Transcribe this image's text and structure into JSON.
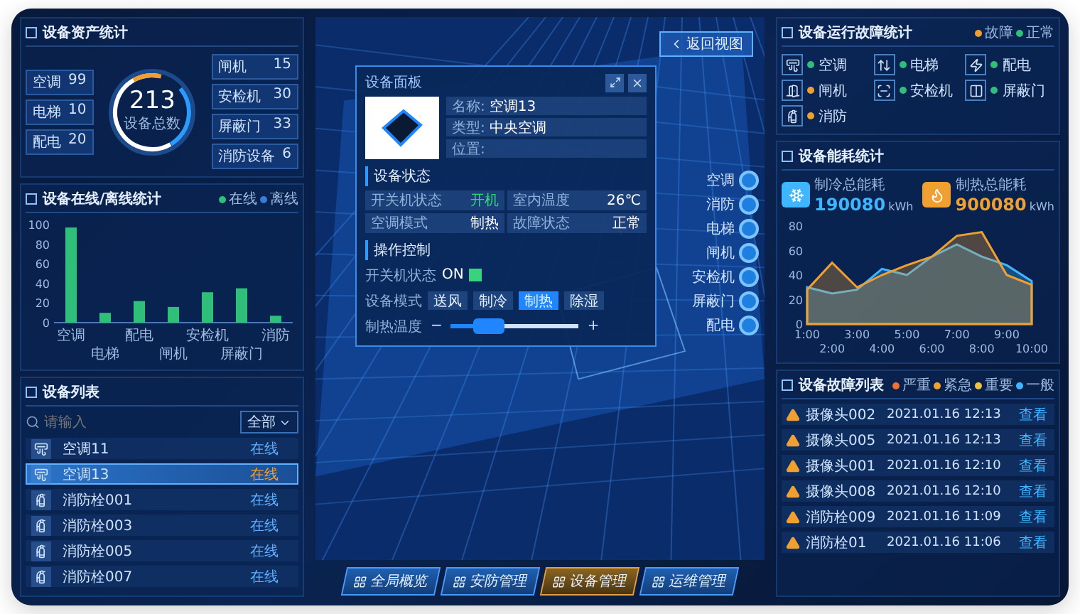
{
  "asset_stats": {
    "title": "设备资产统计",
    "left_items": [
      {
        "label": "空调",
        "value": "99"
      },
      {
        "label": "电梯",
        "value": "10"
      },
      {
        "label": "配电",
        "value": "20"
      }
    ],
    "total": {
      "value": "213",
      "label": "设备总数"
    },
    "right_items": [
      {
        "label": "闸机",
        "value": "15"
      },
      {
        "label": "安检机",
        "value": "30"
      },
      {
        "label": "屏蔽门",
        "value": "33"
      },
      {
        "label": "消防设备",
        "value": "6"
      }
    ]
  },
  "online_stats": {
    "title": "设备在线/离线统计",
    "legend": [
      {
        "label": "在线",
        "color": "#2fbf7a"
      },
      {
        "label": "离线",
        "color": "#3a7bd5"
      }
    ],
    "chart_data": {
      "type": "bar",
      "categories": [
        "空调",
        "电梯",
        "配电",
        "闸机",
        "安检机",
        "屏蔽门",
        "消防"
      ],
      "series": [
        {
          "color": "#2fbf7a",
          "values": [
            97,
            10,
            22,
            16,
            31,
            35,
            7
          ]
        }
      ],
      "ylim": [
        0,
        100
      ],
      "yticks": [
        0,
        20,
        40,
        60,
        80,
        100
      ]
    }
  },
  "device_list": {
    "title": "设备列表",
    "search": {
      "placeholder": "请输入"
    },
    "filter": "全部",
    "rows": [
      {
        "kind": "ac",
        "name": "空调11",
        "status": "在线",
        "selected": false
      },
      {
        "kind": "ac",
        "name": "空调13",
        "status": "在线",
        "selected": true
      },
      {
        "kind": "hydrant",
        "name": "消防栓001",
        "status": "在线",
        "selected": false
      },
      {
        "kind": "hydrant",
        "name": "消防栓003",
        "status": "在线",
        "selected": false
      },
      {
        "kind": "hydrant",
        "name": "消防栓005",
        "status": "在线",
        "selected": false
      },
      {
        "kind": "hydrant",
        "name": "消防栓007",
        "status": "在线",
        "selected": false
      }
    ]
  },
  "scene": {
    "back_button": "返回视图",
    "layers": [
      {
        "label": "空调"
      },
      {
        "label": "消防"
      },
      {
        "label": "电梯"
      },
      {
        "label": "闸机"
      },
      {
        "label": "安检机"
      },
      {
        "label": "屏蔽门"
      },
      {
        "label": "配电"
      }
    ]
  },
  "device_panel": {
    "title": "设备面板",
    "info": [
      {
        "label": "名称:",
        "value": "空调13"
      },
      {
        "label": "类型:",
        "value": "中央空调"
      },
      {
        "label": "位置:"
      }
    ],
    "status": {
      "title": "设备状态",
      "items": [
        {
          "label": "开关机状态",
          "value": "开机",
          "kind": "on"
        },
        {
          "label": "室内温度",
          "value": "26℃",
          "kind": "text"
        },
        {
          "label": "空调模式",
          "value": "制热",
          "kind": "text"
        },
        {
          "label": "故障状态",
          "value": "正常",
          "kind": "text"
        }
      ]
    },
    "control": {
      "title": "操作控制",
      "power": {
        "label": "开关机状态",
        "value": "ON",
        "on": true
      },
      "mode": {
        "label": "设备模式",
        "options": [
          {
            "label": "送风",
            "selected": false
          },
          {
            "label": "制冷",
            "selected": false
          },
          {
            "label": "制热",
            "selected": true
          },
          {
            "label": "除湿",
            "selected": false
          }
        ]
      },
      "temperature": {
        "label": "制热温度",
        "minus": "−",
        "plus": "+",
        "level": 0.3
      }
    }
  },
  "nav": [
    {
      "label": "全局概览",
      "selected": false
    },
    {
      "label": "安防管理",
      "selected": false
    },
    {
      "label": "设备管理",
      "selected": true
    },
    {
      "label": "运维管理",
      "selected": false
    }
  ],
  "fault_stats": {
    "title": "设备运行故障统计",
    "legend": [
      {
        "label": "故障",
        "color": "#f0a030"
      },
      {
        "label": "正常",
        "color": "#2fbf7a"
      }
    ],
    "items": [
      {
        "kind": "ac",
        "label": "空调",
        "color": "#2fbf7a"
      },
      {
        "kind": "elevator",
        "label": "电梯",
        "color": "#2fbf7a"
      },
      {
        "kind": "power",
        "label": "配电",
        "color": "#2fbf7a"
      },
      {
        "kind": "gate",
        "label": "闸机",
        "color": "#f0a030"
      },
      {
        "kind": "scanner",
        "label": "安检机",
        "color": "#2fbf7a"
      },
      {
        "kind": "door",
        "label": "屏蔽门",
        "color": "#2fbf7a"
      },
      {
        "kind": "hydrant",
        "label": "消防",
        "color": "#f0a030"
      }
    ]
  },
  "energy": {
    "title": "设备能耗统计",
    "cards": [
      {
        "kind": "cool",
        "label": "制冷总能耗",
        "value": "190080",
        "unit": "kWh",
        "color": "#3fb6ff"
      },
      {
        "kind": "heat",
        "label": "制热总能耗",
        "value": "900080",
        "unit": "kWh",
        "color": "#f0a030"
      }
    ],
    "chart_data": {
      "type": "area",
      "x": [
        "1:00",
        "2:00",
        "3:00",
        "4:00",
        "5:00",
        "6:00",
        "7:00",
        "8:00",
        "9:00",
        "10:00"
      ],
      "series": [
        {
          "color": "#3fb6ff",
          "values": [
            30,
            25,
            28,
            45,
            40,
            55,
            65,
            55,
            48,
            35
          ]
        },
        {
          "color": "#f0a030",
          "values": [
            28,
            50,
            30,
            40,
            48,
            55,
            72,
            75,
            40,
            32
          ]
        }
      ],
      "ylim": [
        0,
        80
      ],
      "yticks": [
        0,
        20,
        40,
        60,
        80
      ]
    }
  },
  "fault_list": {
    "title": "设备故障列表",
    "legend": [
      {
        "label": "严重",
        "color": "#f07030"
      },
      {
        "label": "紧急",
        "color": "#f0a030"
      },
      {
        "label": "重要",
        "color": "#f0c040"
      },
      {
        "label": "一般",
        "color": "#3fb6ff"
      }
    ],
    "rows": [
      {
        "name": "摄像头002",
        "time": "2021.01.16 12:13",
        "action": "查看"
      },
      {
        "name": "摄像头005",
        "time": "2021.01.16 12:13",
        "action": "查看"
      },
      {
        "name": "摄像头001",
        "time": "2021.01.16 12:10",
        "action": "查看"
      },
      {
        "name": "摄像头008",
        "time": "2021.01.16 12:10",
        "action": "查看"
      },
      {
        "name": "消防栓009",
        "time": "2021.01.16 11:09",
        "action": "查看"
      },
      {
        "name": "消防栓01",
        "time": "2021.01.16 11:06",
        "action": "查看"
      }
    ]
  }
}
